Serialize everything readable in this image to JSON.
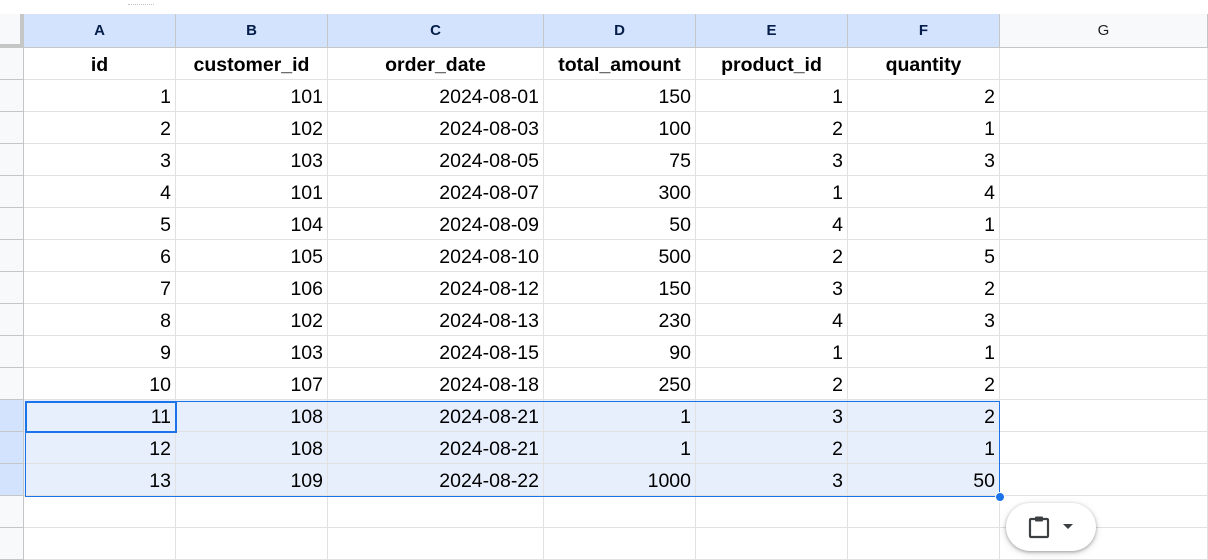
{
  "columns": [
    "A",
    "B",
    "C",
    "D",
    "E",
    "F",
    "G"
  ],
  "headers": [
    "id",
    "customer_id",
    "order_date",
    "total_amount",
    "product_id",
    "quantity"
  ],
  "rows": [
    [
      "1",
      "101",
      "2024-08-01",
      "150",
      "1",
      "2"
    ],
    [
      "2",
      "102",
      "2024-08-03",
      "100",
      "2",
      "1"
    ],
    [
      "3",
      "103",
      "2024-08-05",
      "75",
      "3",
      "3"
    ],
    [
      "4",
      "101",
      "2024-08-07",
      "300",
      "1",
      "4"
    ],
    [
      "5",
      "104",
      "2024-08-09",
      "50",
      "4",
      "1"
    ],
    [
      "6",
      "105",
      "2024-08-10",
      "500",
      "2",
      "5"
    ],
    [
      "7",
      "106",
      "2024-08-12",
      "150",
      "3",
      "2"
    ],
    [
      "8",
      "102",
      "2024-08-13",
      "230",
      "4",
      "3"
    ],
    [
      "9",
      "103",
      "2024-08-15",
      "90",
      "1",
      "1"
    ],
    [
      "10",
      "107",
      "2024-08-18",
      "250",
      "2",
      "2"
    ],
    [
      "11",
      "108",
      "2024-08-21",
      "1",
      "3",
      "2"
    ],
    [
      "12",
      "108",
      "2024-08-21",
      "1",
      "2",
      "1"
    ],
    [
      "13",
      "109",
      "2024-08-22",
      "1000",
      "3",
      "50"
    ]
  ],
  "selected_rows": [
    11,
    12,
    13
  ],
  "active_cell": "A12",
  "icons": {
    "paste": "clipboard-icon",
    "menu": "caret-down-icon"
  },
  "colors": {
    "selection": "#1a73e8",
    "selected_header": "#d3e3fd",
    "selected_fill": "#e8effc"
  }
}
